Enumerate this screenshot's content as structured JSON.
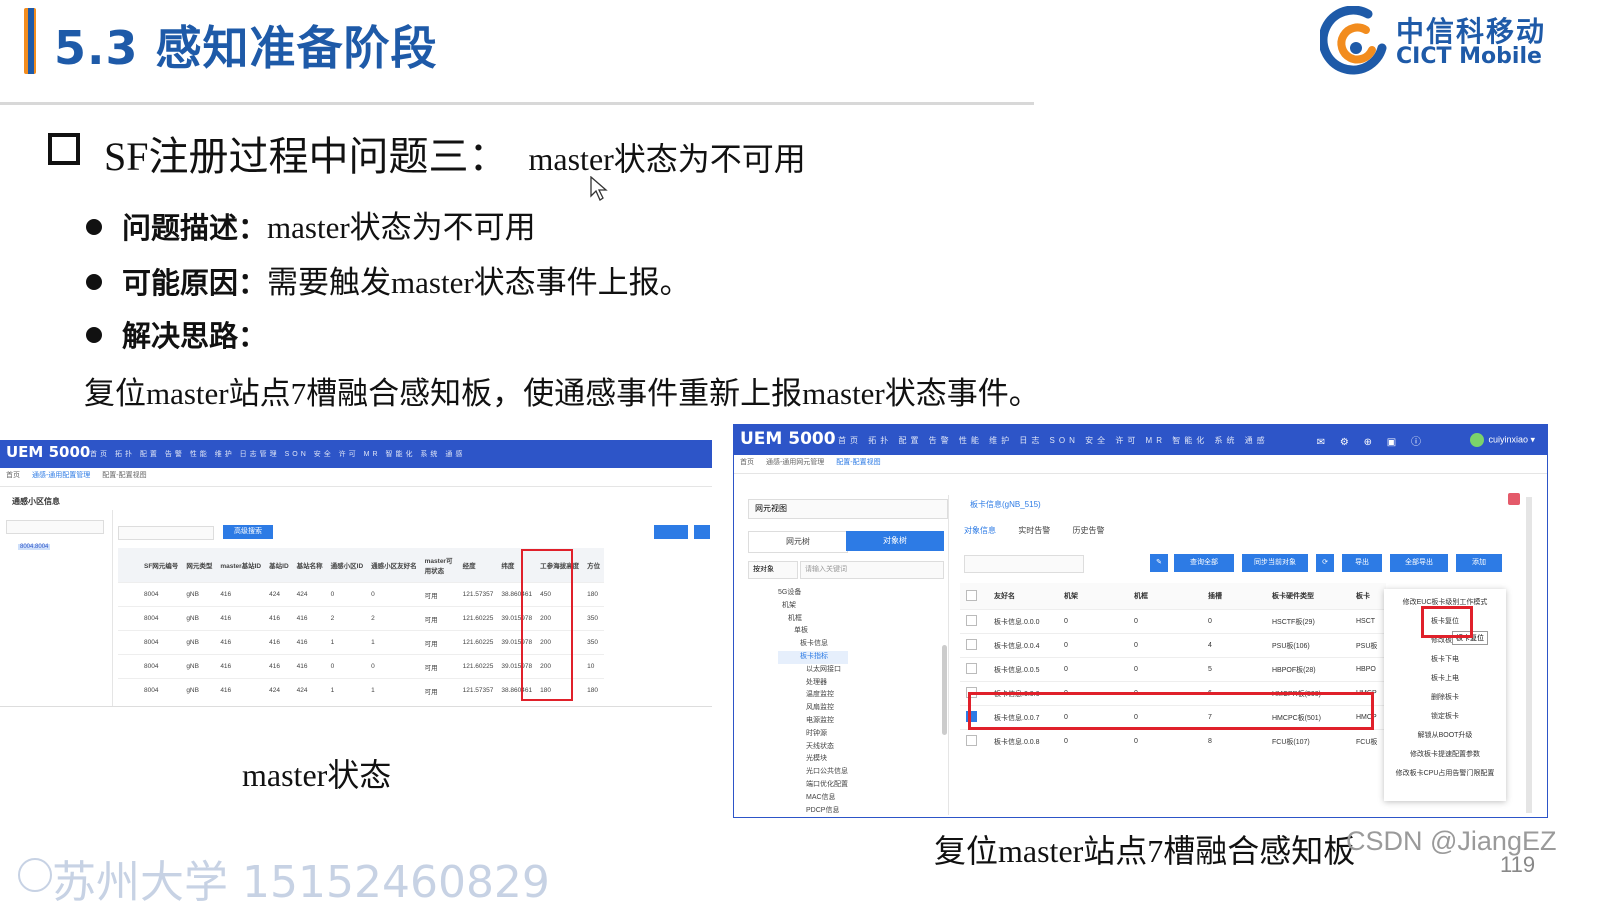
{
  "header": {
    "title": "5.3 感知准备阶段",
    "logo_cn": "中信科移动",
    "logo_en": "CICT Mobile"
  },
  "section": {
    "heading": "SF注册过程中问题三：",
    "heading_sub": "master状态为不可用",
    "bullets": [
      {
        "label": "问题描述：",
        "text": "master状态为不可用"
      },
      {
        "label": "可能原因：",
        "text": "需要触发master状态事件上报。"
      },
      {
        "label": "解决思路：",
        "text": ""
      }
    ],
    "solution": "复位master站点7槽融合感知板，使通感事件重新上报master状态事件。"
  },
  "shot1": {
    "brand": "UEM 5000",
    "menu": "首页 拓扑 配置 告警 性能 维护 日志管理 SON 安全 许可 MR 智能化 系统 通感",
    "tabs": [
      "首页",
      "通感-通用配置管理",
      "配置-配置视图"
    ],
    "panel_title": "通感小区信息",
    "tree_node": "8004.8004",
    "search_btn": "高级搜索",
    "columns": [
      "SF网元编号",
      "网元类型",
      "master基站ID",
      "基站ID",
      "基站名称",
      "通感小区ID",
      "通感小区友好名",
      "master可用状态",
      "经度",
      "纬度",
      "工参海拔高度",
      "方位"
    ],
    "rows": [
      [
        "8004",
        "gNB",
        "416",
        "424",
        "424",
        "0",
        "0",
        "可用",
        "121.57357",
        "38.860461",
        "450",
        "180"
      ],
      [
        "8004",
        "gNB",
        "416",
        "416",
        "416",
        "2",
        "2",
        "可用",
        "121.60225",
        "39.015978",
        "200",
        "350"
      ],
      [
        "8004",
        "gNB",
        "416",
        "416",
        "416",
        "1",
        "1",
        "可用",
        "121.60225",
        "39.015978",
        "200",
        "350"
      ],
      [
        "8004",
        "gNB",
        "416",
        "416",
        "416",
        "0",
        "0",
        "可用",
        "121.60225",
        "39.015978",
        "200",
        "10"
      ],
      [
        "8004",
        "gNB",
        "416",
        "424",
        "424",
        "1",
        "1",
        "可用",
        "121.57357",
        "38.860461",
        "180",
        "180"
      ]
    ]
  },
  "shot2": {
    "brand": "UEM 5000",
    "menu": "首页 拓扑 配置 告警 性能 维护 日志 SON 安全 许可 MR 智能化 系统 通感",
    "user": "cuiyinxiao",
    "tabs": [
      "首页",
      "通感-通用网元管理",
      "配置-配置视图"
    ],
    "left_title": "网元视图",
    "seg_left": "网元树",
    "seg_right": "对象树",
    "filter": "按对象",
    "filter_placeholder": "请输入关键词",
    "tree_items": [
      "5G设备",
      "机架",
      "机框",
      "单板",
      "板卡信息",
      "板卡指标",
      "以太网接口",
      "处理器",
      "温度监控",
      "风扇监控",
      "电源监控",
      "时钟源",
      "天线状态",
      "光模块",
      "光口公共信息",
      "端口优化配置",
      "MAC信息",
      "PDCP信息"
    ],
    "panel_tab": "板卡信息(gNB_515)",
    "sub_tabs": [
      "对象信息",
      "实时告警",
      "历史告警"
    ],
    "toolbar": [
      "查询全部",
      "同步当前对象",
      "导出",
      "全部导出",
      "添加"
    ],
    "columns": [
      "友好名",
      "机架",
      "机框",
      "插槽",
      "板卡硬件类型",
      "板卡"
    ],
    "rows": [
      {
        "name": "板卡信息.0.0.0",
        "rack": "0",
        "frame": "0",
        "slot": "0",
        "hw": "HSCTF板(29)",
        "type": "HSCT",
        "checked": false
      },
      {
        "name": "板卡信息.0.0.4",
        "rack": "0",
        "frame": "0",
        "slot": "4",
        "hw": "PSU板(106)",
        "type": "PSU板",
        "checked": false
      },
      {
        "name": "板卡信息.0.0.5",
        "rack": "0",
        "frame": "0",
        "slot": "5",
        "hw": "HBPOF板(28)",
        "type": "HBPO",
        "checked": false
      },
      {
        "name": "板卡信息.0.0.6",
        "rack": "0",
        "frame": "0",
        "slot": "6",
        "hw": "HMCPR板(500)",
        "type": "HMCP",
        "checked": false
      },
      {
        "name": "板卡信息.0.0.7",
        "rack": "0",
        "frame": "0",
        "slot": "7",
        "hw": "HMCPC板(501)",
        "type": "HMCP",
        "checked": true
      },
      {
        "name": "板卡信息.0.0.8",
        "rack": "0",
        "frame": "0",
        "slot": "8",
        "hw": "FCU板(107)",
        "type": "FCU板",
        "checked": false
      }
    ],
    "context_menu": [
      "修改EUC板卡级别工作模式",
      "板卡复位",
      "修改板卡",
      "板卡下电",
      "板卡上电",
      "删除板卡",
      "锁定板卡",
      "解锁从BOOT升级",
      "修改板卡提速配置参数",
      "修改板卡CPU占用告警门限配置"
    ],
    "tooltip": "板卡复位"
  },
  "captions": {
    "left": "master状态",
    "right": "复位master站点7槽融合感知板"
  },
  "watermark": "CSDN @JiangEZ",
  "page_number": "119",
  "overlay_text": "苏州大学 15152460829"
}
